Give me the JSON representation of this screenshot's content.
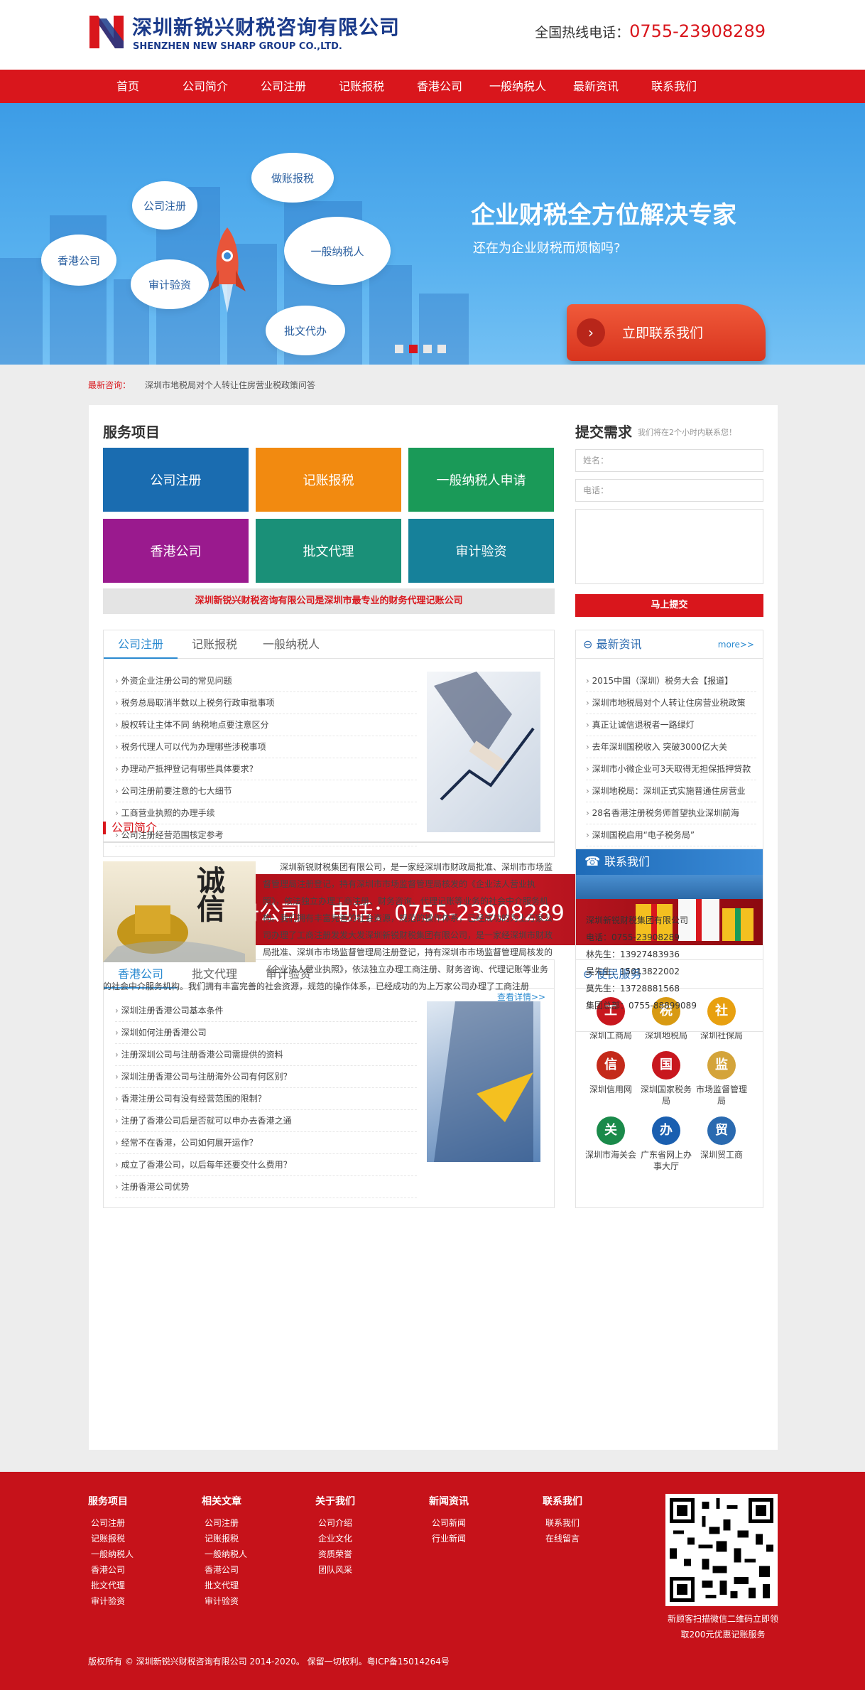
{
  "header": {
    "company_name": "深圳新锐兴财税咨询有限公司",
    "company_en": "SHENZHEN NEW SHARP GROUP CO.,LTD.",
    "hotline_label": "全国热线电话：",
    "hotline_number": "0755-23908289"
  },
  "nav": {
    "items": [
      "首页",
      "公司简介",
      "公司注册",
      "记账报税",
      "香港公司",
      "一般纳税人",
      "最新资讯",
      "联系我们"
    ]
  },
  "banner": {
    "clouds": [
      "公司注册",
      "做账报税",
      "香港公司",
      "审计验资",
      "一般纳税人",
      "批文代办"
    ],
    "title": "企业财税全方位解决专家",
    "subtitle": "还在为企业财税而烦恼吗?",
    "cta": "立即联系我们",
    "slides": 4,
    "active_slide": 2
  },
  "notice": {
    "label": "最新咨询：",
    "text": "深圳市地税局对个人转让住房营业税政策问答"
  },
  "services": {
    "title": "服务项目",
    "tiles": [
      {
        "label": "公司注册",
        "color": "#1a6cb0"
      },
      {
        "label": "记账报税",
        "color": "#f28a10"
      },
      {
        "label": "一般纳税人申请",
        "color": "#1a9a58"
      },
      {
        "label": "香港公司",
        "color": "#9a1a8e"
      },
      {
        "label": "批文代理",
        "color": "#1a9078"
      },
      {
        "label": "审计验资",
        "color": "#16819a"
      }
    ],
    "slogan": "深圳新锐兴财税咨询有限公司是深圳市最专业的财务代理记账公司"
  },
  "request_form": {
    "title": "提交需求",
    "subtitle": "我们将在2个小时内联系您！",
    "name_placeholder": "姓名：",
    "phone_placeholder": "电话：",
    "submit": "马上提交"
  },
  "tab_box_1": {
    "tabs": [
      "公司注册",
      "记账报税",
      "一般纳税人"
    ],
    "items": [
      "外资企业注册公司的常见问题",
      "税务总局取消半数以上税务行政审批事项",
      "股权转让主体不同 纳税地点要注意区分",
      "税务代理人可以代为办理哪些涉税事项",
      "办理动产抵押登记有哪些具体要求?",
      "公司注册前要注意的七大细节",
      "工商营业执照的办理手续",
      "公司注册经营范围核定参考"
    ]
  },
  "news_box": {
    "title": "最新资讯",
    "more": "more>>",
    "items": [
      "2015中国（深圳）税务大会【报道】",
      "深圳市地税局对个人转让住房营业税政策",
      "真正让诚信退税者一路绿灯",
      "去年深圳国税收入 突破3000亿大关",
      "深圳市小微企业可3天取得无担保抵押贷款",
      "深圳地税局：深圳正式实施普通住房营业",
      "28名香港注册税务师首望执业深圳前海",
      "深圳国税启用“电子税务局”"
    ]
  },
  "promo": {
    "text1": "免费注册公司",
    "text2": "电话：0755-23908289"
  },
  "tab_box_2": {
    "tabs": [
      "香港公司",
      "批文代理",
      "审计验资"
    ],
    "items": [
      "深圳注册香港公司基本条件",
      "深圳如何注册香港公司",
      "注册深圳公司与注册香港公司需提供的资料",
      "深圳注册香港公司与注册海外公司有何区别？",
      "香港注册公司有没有经营范围的限制？",
      "注册了香港公司后是否就可以申办去香港之通",
      "经常不在香港，公司如何展开运作？",
      "成立了香港公司，以后每年还要交什么费用？",
      "注册香港公司优势"
    ]
  },
  "convenience": {
    "title": "便民服务",
    "items": [
      {
        "label": "深圳工商局",
        "icon": "gongshang-badge-icon",
        "color": "#c8171e",
        "glyph": "工"
      },
      {
        "label": "深圳地税局",
        "icon": "tax-badge-icon",
        "color": "#d89a12",
        "glyph": "税"
      },
      {
        "label": "深圳社保局",
        "icon": "social-security-icon",
        "color": "#e8a010",
        "glyph": "社"
      },
      {
        "label": "深圳信用网",
        "icon": "credit-seal-icon",
        "color": "#c42a1a",
        "glyph": "信"
      },
      {
        "label": "深圳国家税务局",
        "icon": "national-tax-icon",
        "color": "#c8171e",
        "glyph": "国"
      },
      {
        "label": "市场监督管理局",
        "icon": "market-supervision-icon",
        "color": "#d4a43a",
        "glyph": "监"
      },
      {
        "label": "深圳市海关会",
        "icon": "customs-icon",
        "color": "#1a8a4a",
        "glyph": "关"
      },
      {
        "label": "广东省网上办事大厅",
        "icon": "online-hall-icon",
        "color": "#1a5fb0",
        "glyph": "办"
      },
      {
        "label": "深圳贸工商",
        "icon": "trade-commerce-icon",
        "color": "#2a6ab0",
        "glyph": "贸"
      }
    ]
  },
  "intro": {
    "title": "公司简介",
    "text": "深圳新锐财税集团有限公司，是一家经深圳市财政局批准、深圳市市场监督管理局注册登记，持有深圳市市场监督管理局核发的《企业法人营业执照》，依法独立办理工商注册、财务咨询、代理记账等业务的社会中介服务机构。我们拥有丰富完善的社会资源，规范的操作体系，已经成功的为上万家公司办理了工商注册发发大发深圳新锐财税集团有限公司，是一家经深圳市财政局批准、深圳市市场监督管理局注册登记，持有深圳市市场监督管理局核发的《企业法人营业执照》，依法独立办理工商注册、财务咨询、代理记账等业务的社会中介服务机构。我们拥有丰富完善的社会资源，规范的操作体系，已经成功的为上万家公司办理了工商注册",
    "more": "查看详情>>",
    "image_text": "诚信"
  },
  "contact_box": {
    "title": "联系我们",
    "lines": [
      "深圳新锐财税集团有限公司",
      "电话：0755-23908289",
      "林先生：13927483936",
      "吴先生：15013822002",
      "莫先生：13728881568",
      "集团总部：0755-88899089"
    ]
  },
  "footer": {
    "columns": [
      {
        "title": "服务项目",
        "items": [
          "公司注册",
          "记账报税",
          "一般纳税人",
          "香港公司",
          "批文代理",
          "审计验资"
        ]
      },
      {
        "title": "相关文章",
        "items": [
          "公司注册",
          "记账报税",
          "一般纳税人",
          "香港公司",
          "批文代理",
          "审计验资"
        ]
      },
      {
        "title": "关于我们",
        "items": [
          "公司介绍",
          "企业文化",
          "资质荣誉",
          "团队风采"
        ]
      },
      {
        "title": "新闻资讯",
        "items": [
          "公司新闻",
          "行业新闻"
        ]
      },
      {
        "title": "联系我们",
        "items": [
          "联系我们",
          "在线留言"
        ]
      }
    ],
    "qr_caption_1": "新顾客扫描微信二维码立即领",
    "qr_caption_2": "取200元优惠记账服务",
    "copyright": "版权所有 © 深圳新锐兴财税咨询有限公司 2014-2020。 保留一切权利。粤ICP备15014264号"
  },
  "colors": {
    "brand_red": "#d9161c",
    "brand_blue": "#1a3a8a",
    "link_blue": "#2a8ad0"
  }
}
